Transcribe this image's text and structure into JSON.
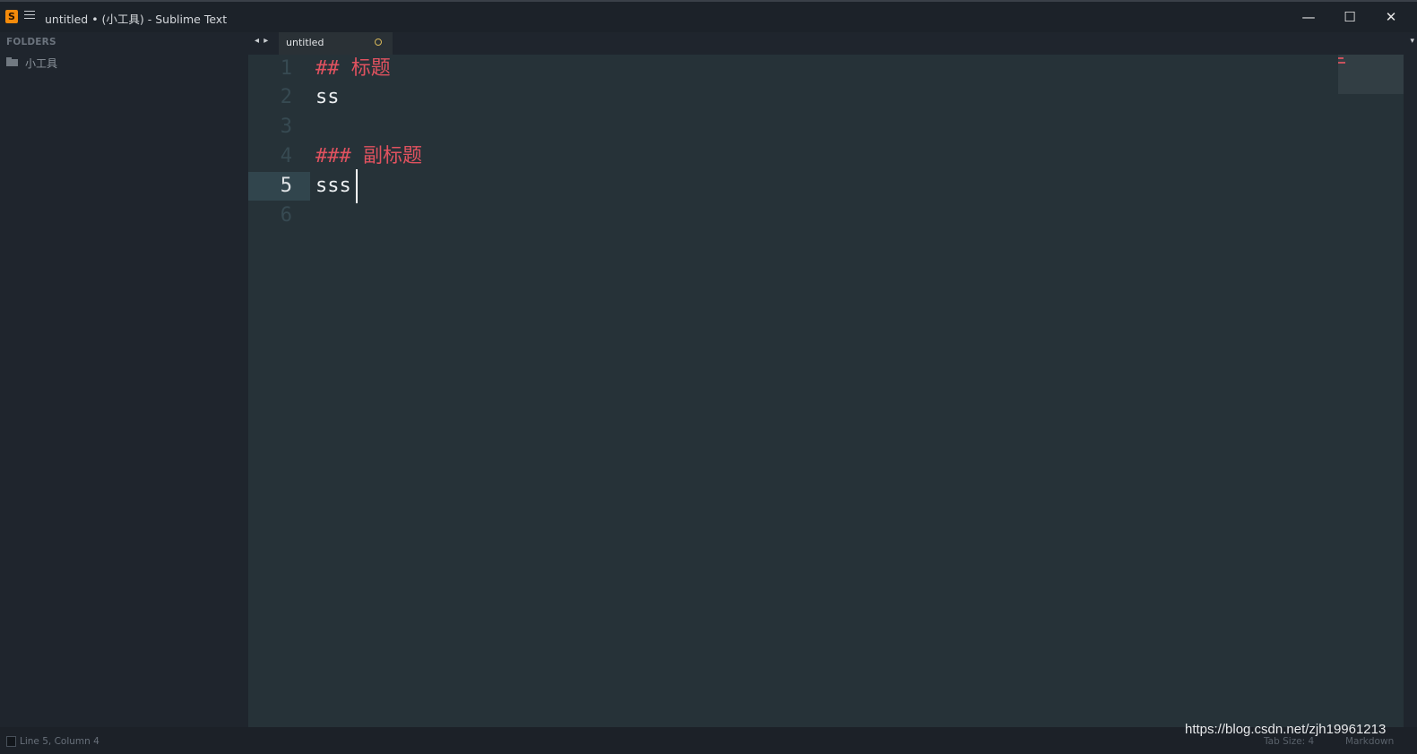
{
  "window": {
    "title": "untitled • (小工具) - Sublime Text",
    "app_icon_letter": "S",
    "controls": {
      "minimize": "—",
      "maximize": "☐",
      "close": "✕"
    }
  },
  "sidebar": {
    "header": "FOLDERS",
    "items": [
      {
        "label": "小工具",
        "icon": "folder-icon"
      }
    ]
  },
  "tabs": {
    "nav": "◂ ▸",
    "items": [
      {
        "label": "untitled",
        "dirty": true
      }
    ],
    "dropdown": "▾"
  },
  "editor": {
    "line_numbers": [
      "1",
      "2",
      "3",
      "4",
      "5",
      "6"
    ],
    "active_line": 5,
    "lines": [
      {
        "hash": "##",
        "text": " 标题",
        "type": "heading"
      },
      {
        "text": "ss",
        "type": "text"
      },
      {
        "text": "",
        "type": "text"
      },
      {
        "hash": "###",
        "text": " 副标题",
        "type": "heading"
      },
      {
        "text": "sss",
        "type": "text"
      },
      {
        "text": "",
        "type": "text"
      }
    ]
  },
  "statusbar": {
    "position": "Line 5, Column 4",
    "tab_size": "Tab Size: 4",
    "syntax": "Markdown"
  },
  "watermark": "https://blog.csdn.net/zjh19961213",
  "colors": {
    "editor_bg": "#263238",
    "heading": "#e0525f",
    "text": "#eceff1",
    "sidebar_bg": "#1f252d"
  }
}
